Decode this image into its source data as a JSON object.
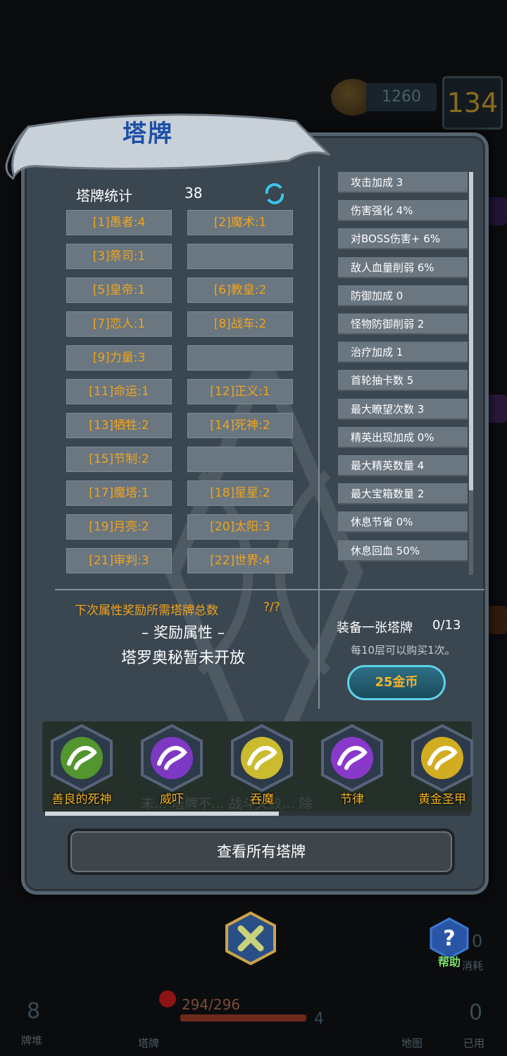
{
  "hud_top": {
    "gold": "1260",
    "level": "134"
  },
  "panel": {
    "title": "塔牌",
    "stats_label": "塔牌统计",
    "stats_count": "38",
    "cards": [
      "[1]愚者:4",
      "[2]魔术:1",
      "[3]祭司:1",
      "",
      "[5]皇帝:1",
      "[6]教皇:2",
      "[7]恋人:1",
      "[8]战车:2",
      "[9]力量:3",
      "",
      "[11]命运:1",
      "[12]正义:1",
      "[13]牺牲:2",
      "[14]死神:2",
      "[15]节制:2",
      "",
      "[17]魔塔:1",
      "[18]星星:2",
      "[19]月亮:2",
      "[20]太阳:3",
      "[21]审判:3",
      "[22]世界:4"
    ],
    "attributes": [
      "攻击加成 3",
      "伤害强化 4%",
      "对BOSS伤害+ 6%",
      "敌人血量削弱 6%",
      "防御加成 0",
      "怪物防御削弱 2",
      "治疗加成 1",
      "首轮抽卡数 5",
      "最大瞭望次数 3",
      "精英出现加成 0%",
      "最大精英数量 4",
      "最大宝箱数量 2",
      "休息节省 0%",
      "休息回血 50%"
    ],
    "attribute_scroll": 0.79,
    "reward_need_label": "下次属性奖励所需塔牌总数",
    "reward_need_value": "?/?",
    "reward_attr_label": "– 奖励属性 –",
    "reward_closed_text": "塔罗奥秘暂未开放",
    "equip_label": "装备一张塔牌",
    "equip_count": "0/13",
    "equip_note": "每10层可以购买1次。",
    "buy_button": "25金币",
    "strip_cards": [
      {
        "name": "善良的死神",
        "icon": "green-scythe-icon",
        "color": "#5aa62a"
      },
      {
        "name": "威吓",
        "icon": "purple-claw-icon",
        "color": "#8c3ad8"
      },
      {
        "name": "吞魔",
        "icon": "yellow-face-icon",
        "color": "#e6d22a"
      },
      {
        "name": "节律",
        "icon": "purple-rune-icon",
        "color": "#9a3ae0"
      },
      {
        "name": "黄金圣甲",
        "icon": "gold-swirl-icon",
        "color": "#f0c21a"
      }
    ],
    "strip_bg_text": "未... 塔牌不... 战斗失败... 除",
    "strip_scroll": 0.55,
    "view_all_button": "查看所有塔牌"
  },
  "help_label": "帮助",
  "hud_bottom": {
    "deck_count": "8",
    "deck_label": "牌堆",
    "tarot_label": "塔牌",
    "hp": "294/296",
    "hp_fraction": 0.99,
    "shield": "4",
    "map_label": "地图",
    "used_count": "0",
    "used_label": "已用",
    "consume_count": "0",
    "consume_label": "消耗"
  }
}
